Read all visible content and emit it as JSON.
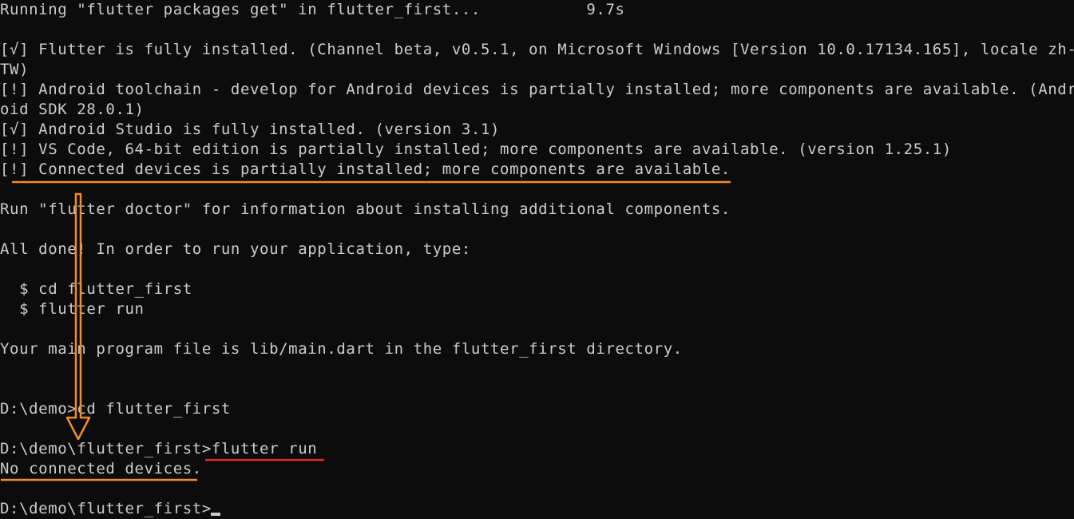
{
  "terminal": {
    "lines": [
      "Running \"flutter packages get\" in flutter_first...           9.7s",
      "",
      "[√] Flutter is fully installed. (Channel beta, v0.5.1, on Microsoft Windows [Version 10.0.17134.165], locale zh-",
      "TW)",
      "[!] Android toolchain - develop for Android devices is partially installed; more components are available. (Andr",
      "oid SDK 28.0.1)",
      "[√] Android Studio is fully installed. (version 3.1)",
      "[!] VS Code, 64-bit edition is partially installed; more components are available. (version 1.25.1)",
      "[!] Connected devices is partially installed; more components are available.",
      "",
      "Run \"flutter doctor\" for information about installing additional components.",
      "",
      "All done! In order to run your application, type:",
      "",
      "  $ cd flutter_first",
      "  $ flutter run",
      "",
      "Your main program file is lib/main.dart in the flutter_first directory.",
      "",
      "",
      "D:\\demo>cd flutter_first",
      "",
      "D:\\demo\\flutter_first>flutter run",
      "No connected devices.",
      "",
      "D:\\demo\\flutter_first>"
    ]
  },
  "colors": {
    "background": "#0c0c0c",
    "text": "#cccccc",
    "annotation_orange": "#f28c28",
    "annotation_red": "#e0282d"
  }
}
